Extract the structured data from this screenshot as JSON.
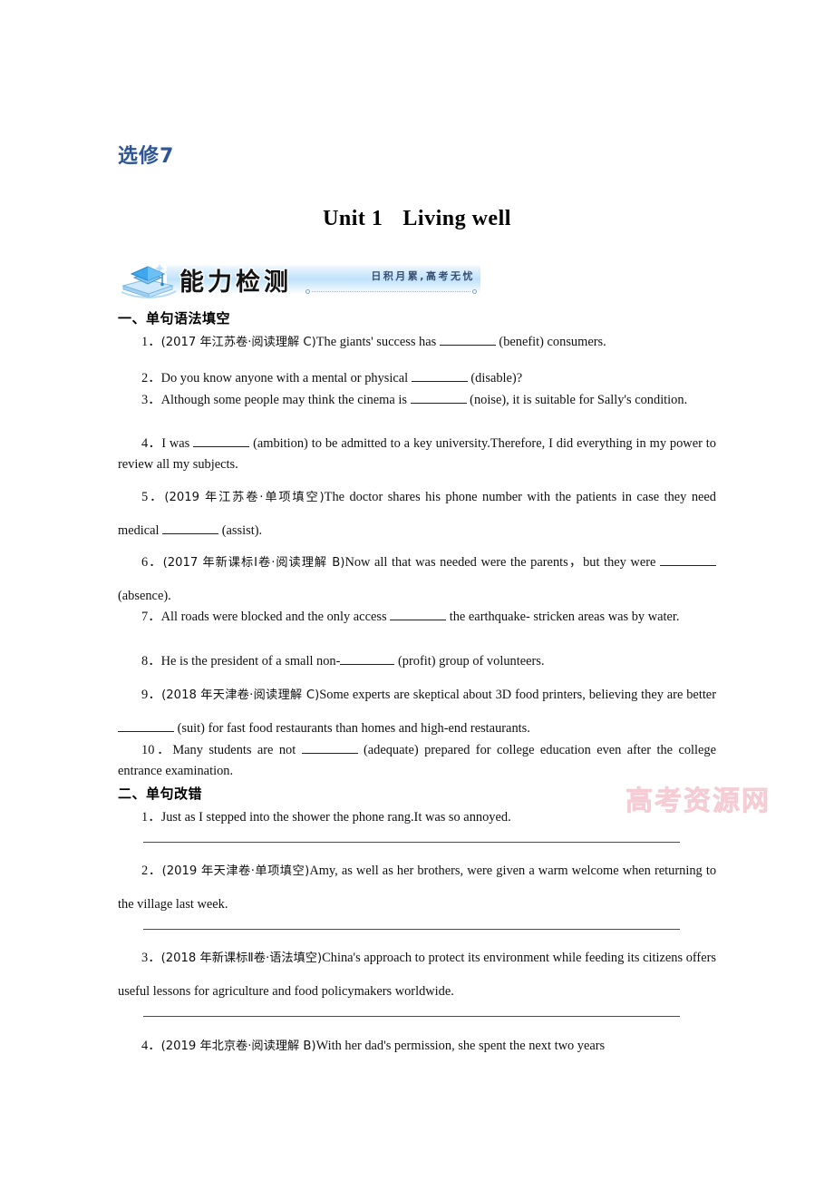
{
  "document": {
    "volume_label": "选修7",
    "unit_title_prefix": "Unit 1",
    "unit_title_name": "Living well",
    "watermark": "高考资源网"
  },
  "banner": {
    "title": "能力检测",
    "motto": "日积月累,高考无忧",
    "icon": "graduation-cap-book-icon"
  },
  "sections": [
    {
      "heading": "一、单句语法填空"
    },
    {
      "heading": "二、单句改错"
    }
  ],
  "grammar_fill": [
    {
      "number": "1．",
      "source": "(2017 年江苏卷·阅读理解 C)",
      "text_before": "The giants' success has ",
      "text_after": " (benefit) consumers."
    },
    {
      "number": "2．",
      "source": "",
      "text_before": "Do you know anyone with a mental or physical ",
      "text_after": " (disable)?"
    },
    {
      "number": "3．",
      "source": "",
      "text_before": "Although some people may think the cinema is ",
      "text_after": " (noise), it is suitable for Sally's condition."
    },
    {
      "number": "4．",
      "source": "",
      "text_before": "I was ",
      "text_after": " (ambition) to be admitted to a key university.Therefore, I did everything in my power to review all my subjects."
    },
    {
      "number": "5．",
      "source": "(2019 年江苏卷·单项填空)",
      "text_before": "The doctor shares his phone number with the patients in case they need medical ",
      "text_after": " (assist)."
    },
    {
      "number": "6．",
      "source": "(2017 年新课标Ⅰ卷·阅读理解 B)",
      "text_before": "Now all that was needed were the parents，but they were ",
      "text_after": " (absence)."
    },
    {
      "number": "7．",
      "source": "",
      "text_before": "All roads were blocked and the only access ",
      "text_after": " the earthquake- stricken areas was by water."
    },
    {
      "number": "8．",
      "source": "",
      "text_before": "He is the president of a small non-",
      "text_after": " (profit) group of volunteers."
    },
    {
      "number": "9．",
      "source": "(2018 年天津卷·阅读理解 C)",
      "text_before": "Some experts are skeptical about 3D food printers, believing they are better ",
      "text_after": " (suit) for fast food restaurants than homes and high-end restaurants."
    },
    {
      "number": "10．",
      "source": "",
      "text_before": "Many students are not ",
      "text_after": " (adequate) prepared for college education even after the college entrance examination."
    }
  ],
  "error_correction": [
    {
      "number": "1．",
      "source": "",
      "text": "Just as I stepped into the shower the phone rang.It was so annoyed."
    },
    {
      "number": "2．",
      "source": "(2019 年天津卷·单项填空)",
      "text": "Amy, as well as her brothers, were given a warm welcome when returning to the village last week."
    },
    {
      "number": "3．",
      "source": "(2018 年新课标Ⅱ卷·语法填空)",
      "text": "China's approach to protect its environment while feeding its citizens offers useful lessons for agriculture and food policymakers worldwide."
    },
    {
      "number": "4．",
      "source": "(2019 年北京卷·阅读理解 B)",
      "text": "With her dad's permission, she spent the next two years"
    }
  ]
}
